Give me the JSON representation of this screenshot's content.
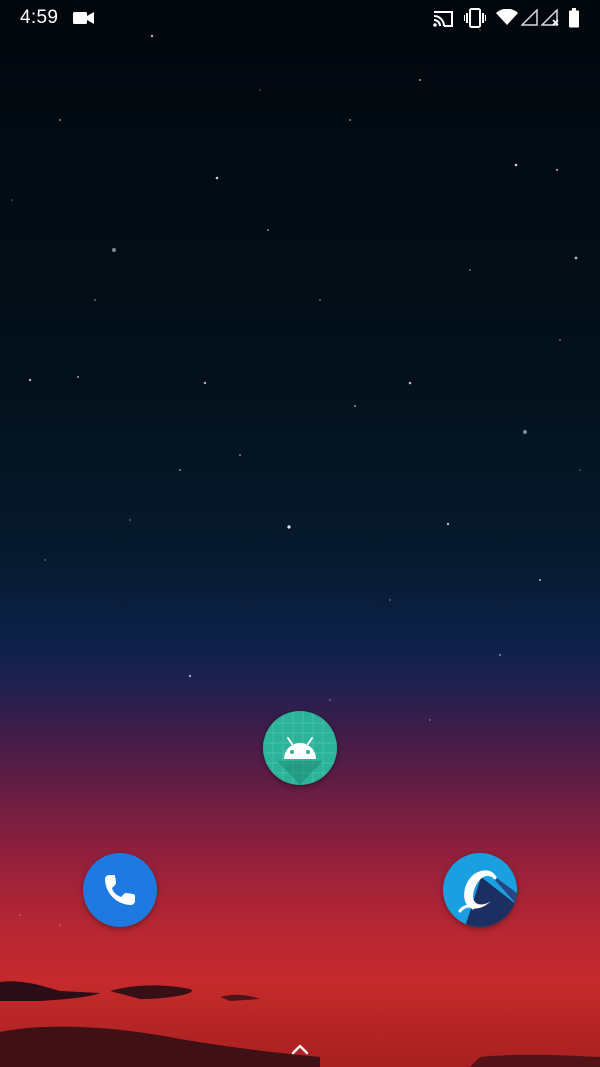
{
  "status_bar": {
    "time": "4:59",
    "icons": [
      "video-camera-icon",
      "cast-icon",
      "vibrate-icon",
      "wifi-icon",
      "signal-icon",
      "signal-no-data-icon",
      "battery-icon"
    ]
  },
  "home_screen": {
    "apps": [
      {
        "name": "android-app",
        "icon": "android-robot-icon",
        "color": "#2bb39a"
      },
      {
        "name": "phone-app",
        "icon": "phone-handset-icon",
        "color": "#1e7ae0"
      },
      {
        "name": "cursive-c-app",
        "icon": "cursive-c-icon",
        "color": "#1a9fe0"
      }
    ],
    "app_drawer_icon": "chevron-up-icon"
  },
  "colors": {
    "sky_top": "#02070d",
    "horizon_red": "#c52a2c"
  }
}
